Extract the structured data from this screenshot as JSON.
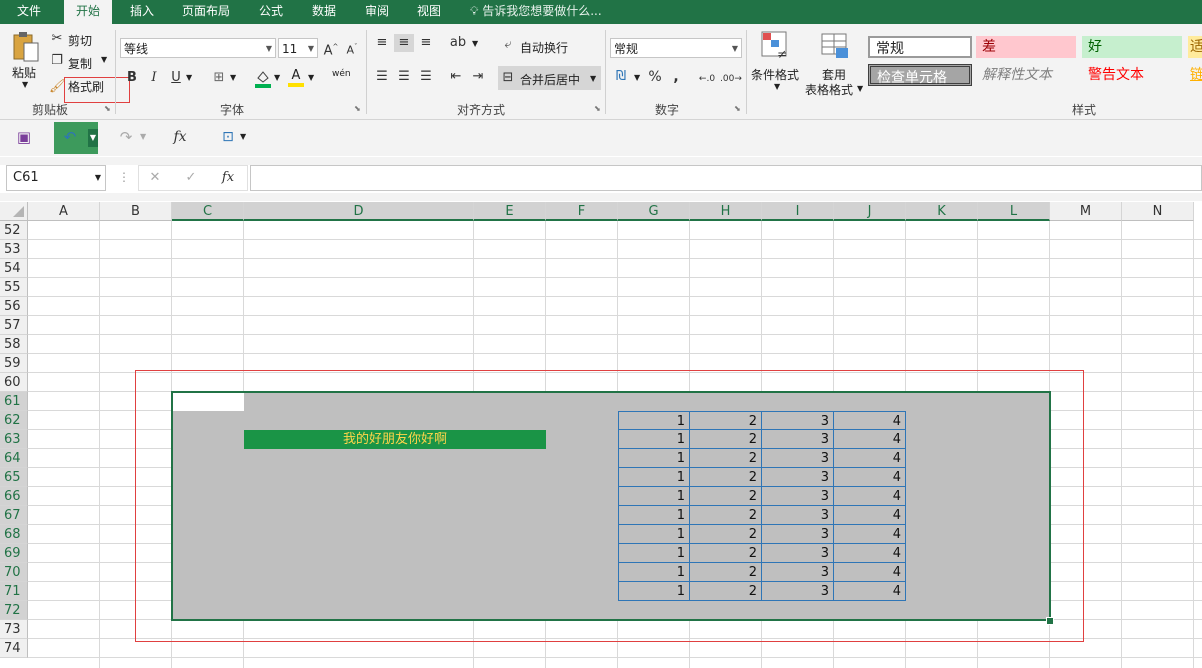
{
  "tabs": [
    "文件",
    "开始",
    "插入",
    "页面布局",
    "公式",
    "数据",
    "审阅",
    "视图"
  ],
  "tell_me": "告诉我您想要做什么...",
  "clipboard": {
    "paste": "粘贴",
    "cut": "剪切",
    "copy": "复制",
    "format_painter": "格式刷",
    "label": "剪贴板"
  },
  "font": {
    "name": "等线",
    "size": "11",
    "bold": "B",
    "italic": "I",
    "underline": "U",
    "pinyin": "wén",
    "label": "字体"
  },
  "alignment": {
    "wrap": "自动换行",
    "merge": "合并后居中",
    "label": "对齐方式"
  },
  "number": {
    "format": "常规",
    "percent": "%",
    "comma": ",",
    "label": "数字"
  },
  "styles": {
    "conditional": "条件格式",
    "table_format_1": "套用",
    "table_format_2": "表格格式",
    "normal": "常规",
    "bad": "差",
    "good": "好",
    "neutral": "适",
    "check_cell": "检查单元格",
    "explanatory": "解释性文本",
    "warning": "警告文本",
    "link": "链",
    "label": "样式"
  },
  "formula_bar": {
    "name_box": "C61",
    "fx": "fx",
    "value": ""
  },
  "columns": [
    "A",
    "B",
    "C",
    "D",
    "E",
    "F",
    "G",
    "H",
    "I",
    "J",
    "K",
    "L",
    "M",
    "N"
  ],
  "rows": [
    "52",
    "53",
    "54",
    "55",
    "56",
    "57",
    "58",
    "59",
    "60",
    "61",
    "62",
    "63",
    "64",
    "65",
    "66",
    "67",
    "68",
    "69",
    "70",
    "71",
    "72",
    "73",
    "74"
  ],
  "merged_text": "我的好朋友你好啊",
  "table_rows": [
    [
      1,
      2,
      3,
      4
    ],
    [
      1,
      2,
      3,
      4
    ],
    [
      1,
      2,
      3,
      4
    ],
    [
      1,
      2,
      3,
      4
    ],
    [
      1,
      2,
      3,
      4
    ],
    [
      1,
      2,
      3,
      4
    ],
    [
      1,
      2,
      3,
      4
    ],
    [
      1,
      2,
      3,
      4
    ],
    [
      1,
      2,
      3,
      4
    ],
    [
      1,
      2,
      3,
      4
    ]
  ],
  "colors": {
    "accent": "#217346",
    "selection_fill": "#bfbfbf",
    "merged_fill": "#1a9446",
    "merged_text": "#ffd54a",
    "red_box": "#e04040",
    "table_border": "#2e75b6"
  }
}
